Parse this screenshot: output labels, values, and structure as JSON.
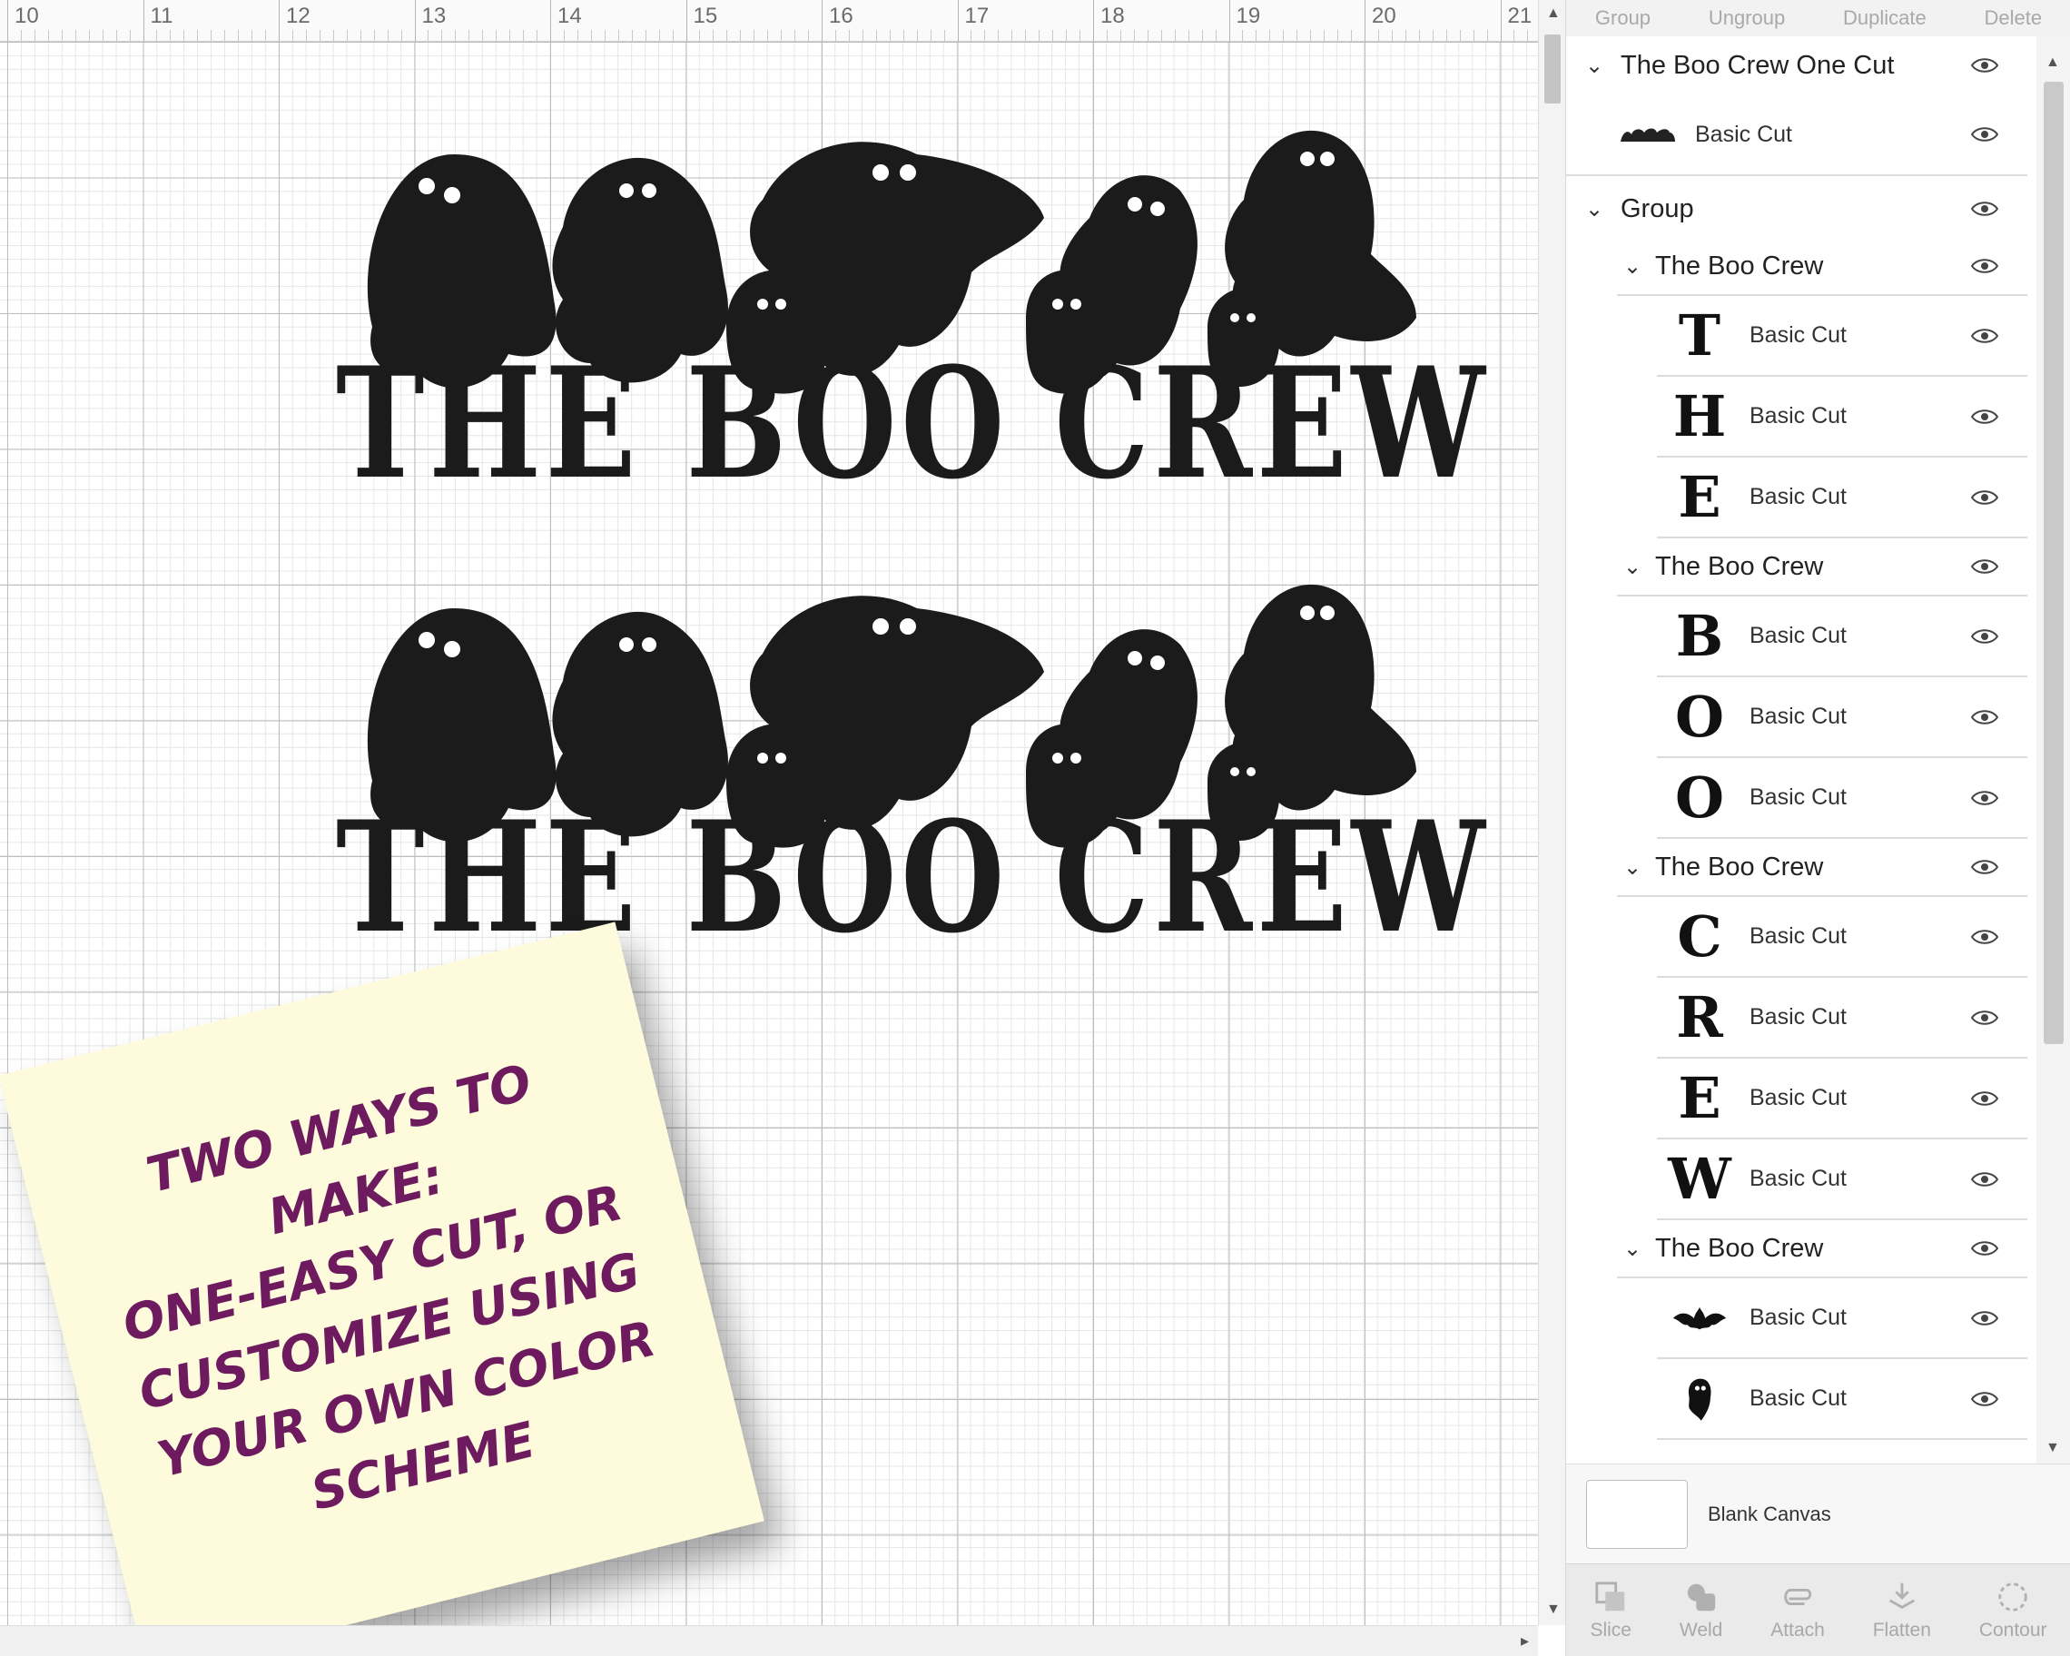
{
  "ruler": {
    "labels": [
      "10",
      "11",
      "12",
      "13",
      "14",
      "15",
      "16",
      "17",
      "18",
      "19",
      "20",
      "21"
    ]
  },
  "design": {
    "text": "THE BOO CREW"
  },
  "sticky_note": {
    "lines": [
      "TWO WAYS TO MAKE:",
      "ONE-EASY CUT, OR",
      "CUSTOMIZE USING",
      "YOUR OWN COLOR",
      "SCHEME"
    ],
    "text_color": "#6d1a5f",
    "bg_color": "#fdfbdc"
  },
  "toolbar": {
    "group": "Group",
    "ungroup": "Ungroup",
    "duplicate": "Duplicate",
    "delete": "Delete"
  },
  "layers": {
    "one_cut": {
      "name": "The Boo Crew One Cut",
      "sub": "Basic Cut"
    },
    "group": {
      "name": "Group"
    },
    "sub_groups": [
      {
        "name": "The Boo Crew",
        "items": [
          {
            "glyph": "T",
            "label": "Basic Cut"
          },
          {
            "glyph": "H",
            "label": "Basic Cut"
          },
          {
            "glyph": "E",
            "label": "Basic Cut"
          }
        ]
      },
      {
        "name": "The Boo Crew",
        "items": [
          {
            "glyph": "B",
            "label": "Basic Cut"
          },
          {
            "glyph": "O",
            "label": "Basic Cut"
          },
          {
            "glyph": "O",
            "label": "Basic Cut"
          }
        ]
      },
      {
        "name": "The Boo Crew",
        "items": [
          {
            "glyph": "C",
            "label": "Basic Cut"
          },
          {
            "glyph": "R",
            "label": "Basic Cut"
          },
          {
            "glyph": "E",
            "label": "Basic Cut"
          },
          {
            "glyph": "W",
            "label": "Basic Cut"
          }
        ]
      },
      {
        "name": "The Boo Crew",
        "items": [
          {
            "glyph": "bat",
            "label": "Basic Cut"
          },
          {
            "glyph": "ghost",
            "label": "Basic Cut"
          }
        ]
      }
    ]
  },
  "blank_canvas": {
    "label": "Blank Canvas"
  },
  "bottom_tools": {
    "slice": "Slice",
    "weld": "Weld",
    "attach": "Attach",
    "flatten": "Flatten",
    "contour": "Contour"
  }
}
